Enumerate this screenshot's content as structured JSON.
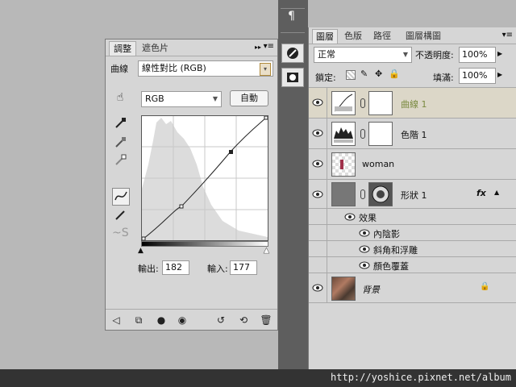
{
  "adjustments": {
    "tabs": [
      "調整",
      "遮色片"
    ],
    "preset_label": "曲線",
    "preset_value": "線性對比 (RGB)",
    "channel_value": "RGB",
    "auto_button": "自動",
    "output_label": "輸出:",
    "output_value": "182",
    "input_label": "輸入:",
    "input_value": "177"
  },
  "layers": {
    "tabs": [
      "圖層",
      "色版",
      "路徑",
      "圖層構圖"
    ],
    "blend_mode": "正常",
    "opacity_label": "不透明度:",
    "opacity_value": "100%",
    "lock_label": "鎖定:",
    "fill_label": "填滿:",
    "fill_value": "100%",
    "items": [
      {
        "name": "曲線 1"
      },
      {
        "name": "色階 1"
      },
      {
        "name": "woman"
      },
      {
        "name": "形狀 1",
        "badge": "fx"
      },
      {
        "name": "效果"
      },
      {
        "name": "內陰影"
      },
      {
        "name": "斜角和浮雕"
      },
      {
        "name": "顏色覆蓋"
      },
      {
        "name": "背景"
      }
    ]
  },
  "watermark": "http://yoshice.pixnet.net/album",
  "dock_icons": [
    "paragraph-icon",
    "brush-preset-icon",
    "mask-icon"
  ],
  "colors": {
    "selected_layer": "#dcd7c8",
    "curve_layer_text": "#7a8a40",
    "panel_bg": "#d6d6d6"
  }
}
